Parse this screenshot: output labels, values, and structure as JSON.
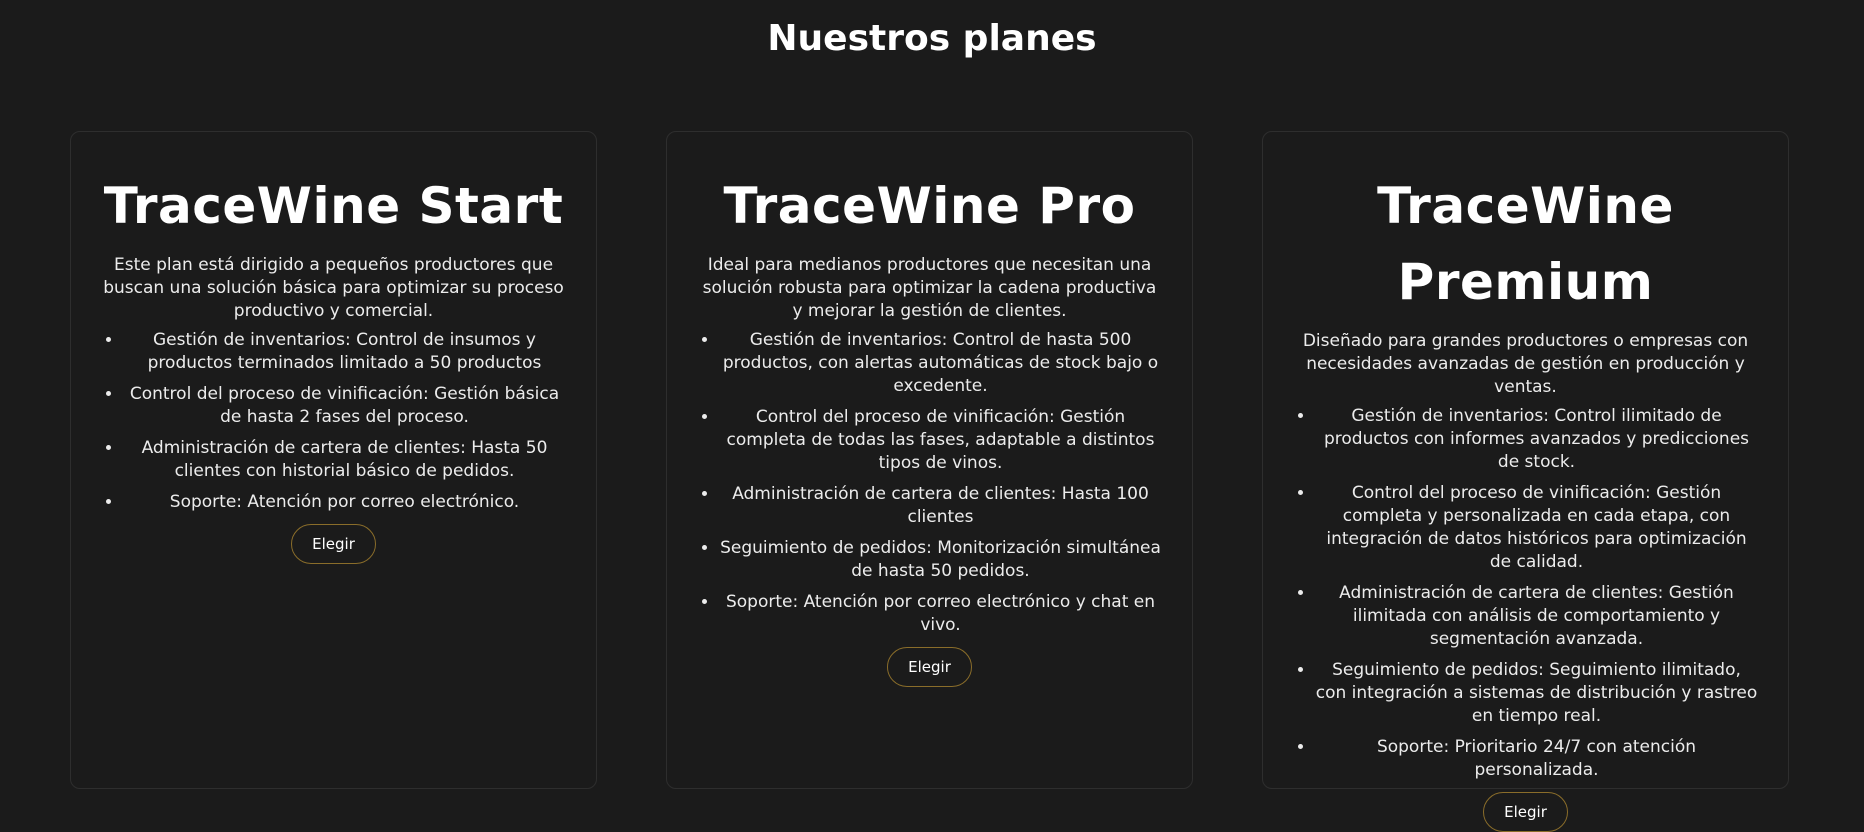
{
  "section": {
    "title": "Nuestros planes"
  },
  "plans": [
    {
      "name": "TraceWine Start",
      "description": "Este plan está dirigido a pequeños productores que buscan una solución básica para optimizar su proceso productivo y comercial.",
      "features": [
        "Gestión de inventarios: Control de insumos y productos terminados limitado a 50 productos",
        "Control del proceso de vinificación: Gestión básica de hasta 2 fases del proceso.",
        "Administración de cartera de clientes: Hasta 50 clientes con historial básico de pedidos.",
        "Soporte: Atención por correo electrónico."
      ],
      "button_label": "Elegir"
    },
    {
      "name": "TraceWine Pro",
      "description": "Ideal para medianos productores que necesitan una solución robusta para optimizar la cadena productiva y mejorar la gestión de clientes.",
      "features": [
        "Gestión de inventarios: Control de hasta 500 productos, con alertas automáticas de stock bajo o excedente.",
        "Control del proceso de vinificación: Gestión completa de todas las fases, adaptable a distintos tipos de vinos.",
        "Administración de cartera de clientes: Hasta 100 clientes",
        "Seguimiento de pedidos: Monitorización simultánea de hasta 50 pedidos.",
        "Soporte: Atención por correo electrónico y chat en vivo."
      ],
      "button_label": "Elegir"
    },
    {
      "name": "TraceWine Premium",
      "description": "Diseñado para grandes productores o empresas con necesidades avanzadas de gestión en producción y ventas.",
      "features": [
        "Gestión de inventarios: Control ilimitado de productos con informes avanzados y predicciones de stock.",
        "Control del proceso de vinificación: Gestión completa y personalizada en cada etapa, con integración de datos históricos para optimización de calidad.",
        "Administración de cartera de clientes: Gestión ilimitada con análisis de comportamiento y segmentación avanzada.",
        "Seguimiento de pedidos: Seguimiento ilimitado, con integración a sistemas de distribución y rastreo en tiempo real.",
        "Soporte: Prioritario 24/7 con atención personalizada."
      ],
      "button_label": "Elegir"
    }
  ],
  "colors": {
    "background": "#1b1b1b",
    "card_border": "#2e2e2e",
    "button_border": "#8a6d2a",
    "text": "#ffffff"
  }
}
